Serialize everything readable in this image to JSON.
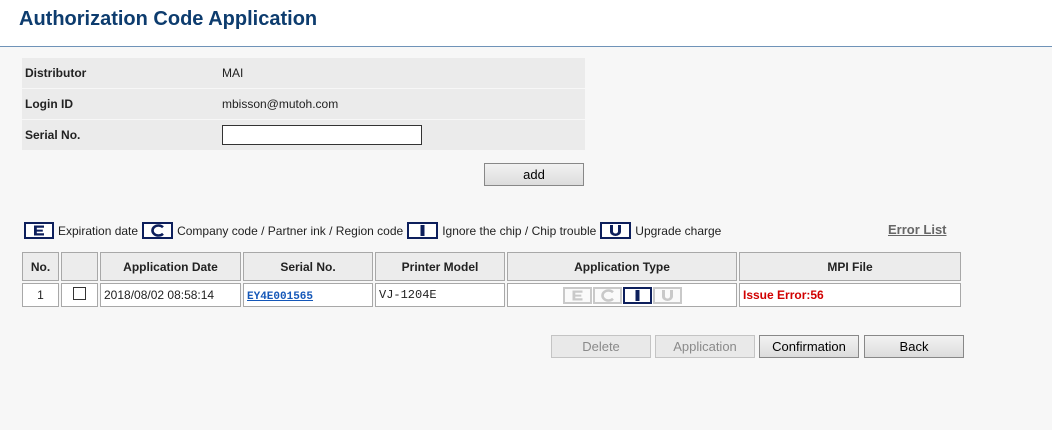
{
  "page": {
    "title": "Authorization Code Application"
  },
  "info": {
    "distributor_label": "Distributor",
    "distributor_value": "MAI",
    "login_label": "Login ID",
    "login_value": "mbisson@mutoh.com",
    "serial_label": "Serial No.",
    "serial_value": ""
  },
  "buttons": {
    "add": "add",
    "delete": "Delete",
    "application": "Application",
    "confirmation": "Confirmation",
    "back": "Back"
  },
  "legend": {
    "expiration": "Expiration date",
    "company": "Company code / Partner ink / Region code",
    "ignore": "Ignore the chip / Chip trouble",
    "upgrade": "Upgrade charge",
    "error_list": "Error List"
  },
  "table": {
    "headers": [
      "No.",
      "",
      "Application Date",
      "Serial No.",
      "Printer Model",
      "Application Type",
      "MPI File"
    ],
    "rows": [
      {
        "no": "1",
        "date": "2018/08/02 08:58:14",
        "serial": "EY4E001565",
        "model": "VJ-1204E",
        "types": {
          "E": false,
          "C": false,
          "I": true,
          "U": false
        },
        "mpi": "Issue Error:56"
      }
    ]
  },
  "colors": {
    "title": "#0d3c6e",
    "error": "#d10000",
    "link": "#1457b8",
    "icon_border": "#0d1f5c"
  }
}
